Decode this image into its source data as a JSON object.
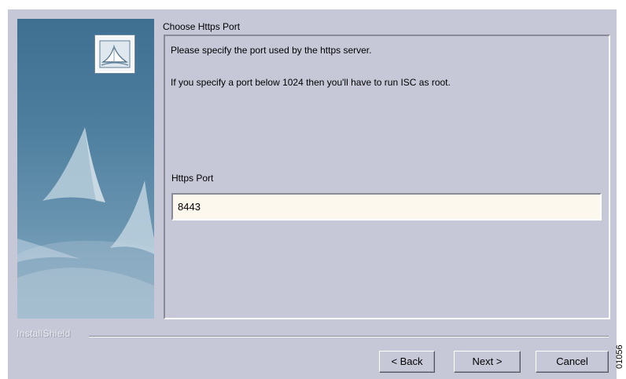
{
  "header": {
    "step_title": "Choose Https Port"
  },
  "content": {
    "description_1": "Please specify the port used by the https server.",
    "description_2": "If you specify a port  below 1024 then you'll have to run ISC as root.",
    "port_label": "Https Port",
    "port_value": "8443"
  },
  "footer": {
    "brand": "InstallShield",
    "back_label": "< Back",
    "next_label": "Next >",
    "cancel_label": "Cancel"
  },
  "figure_code": "01056",
  "icons": {
    "installer_logo": "installer-logo-icon",
    "side_art": "tent-artwork"
  },
  "colors": {
    "dialog_background": "#c6c8d8",
    "input_background": "#fdf8ee",
    "side_panel_top": "#3f6f91",
    "side_panel_bottom": "#8fb0c6"
  }
}
